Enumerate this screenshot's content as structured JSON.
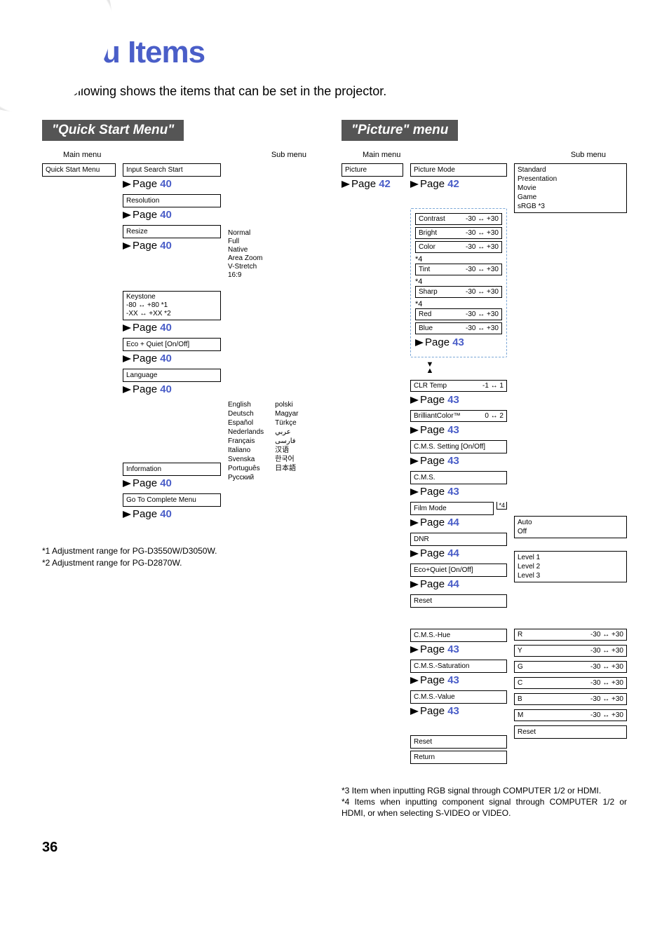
{
  "title": "Menu Items",
  "intro": "The following shows the items that can be set in the projector.",
  "main_menu_label": "Main menu",
  "sub_menu_label": "Sub menu",
  "page_word": "Page",
  "page_number": "36",
  "quick_start": {
    "header": "\"Quick Start Menu\"",
    "main_box": "Quick Start Menu",
    "items": {
      "input_search": {
        "label": "Input Search Start",
        "page": "40"
      },
      "resolution": {
        "label": "Resolution",
        "page": "40"
      },
      "resize": {
        "label": "Resize",
        "page": "40",
        "sub": [
          "Normal",
          "Full",
          "Native",
          "Area Zoom",
          "V-Stretch",
          "16:9"
        ]
      },
      "keystone": {
        "label": "Keystone",
        "l1": "-80 ↔ +80 *1",
        "l2": "-XX ↔ +XX *2",
        "page": "40"
      },
      "eco_quiet": {
        "label": "Eco + Quiet [On/Off]",
        "page": "40"
      },
      "language": {
        "label": "Language",
        "page": "40",
        "left": [
          "English",
          "Deutsch",
          "Español",
          "Nederlands",
          "Français",
          "Italiano",
          "Svenska",
          "Português",
          "Русский"
        ],
        "right": [
          "polski",
          "Magyar",
          "Türkçe",
          "عربي",
          "فارسی",
          "汉语",
          "한국어",
          "日本語"
        ]
      },
      "information": {
        "label": "Information",
        "page": "40"
      },
      "goto_complete": {
        "label": "Go To Complete Menu",
        "page": "40"
      }
    },
    "footnotes": {
      "f1": "*1 Adjustment range for PG-D3550W/D3050W.",
      "f2": "*2 Adjustment range for PG-D2870W."
    }
  },
  "picture": {
    "header": "\"Picture\" menu",
    "main_box": "Picture",
    "main_page": "42",
    "picture_mode": {
      "label": "Picture Mode",
      "page": "42",
      "sub": [
        "Standard",
        "Presentation",
        "Movie",
        "Game",
        "sRGB *3"
      ]
    },
    "adjust_group": [
      {
        "name": "Contrast",
        "range": "-30 ↔ +30",
        "ann": ""
      },
      {
        "name": "Bright",
        "range": "-30 ↔ +30",
        "ann": ""
      },
      {
        "name": "Color",
        "range": "-30 ↔ +30",
        "ann": "*4"
      },
      {
        "name": "Tint",
        "range": "-30 ↔ +30",
        "ann": "*4"
      },
      {
        "name": "Sharp",
        "range": "-30 ↔ +30",
        "ann": "*4"
      },
      {
        "name": "Red",
        "range": "-30 ↔ +30",
        "ann": ""
      },
      {
        "name": "Blue",
        "range": "-30 ↔ +30",
        "ann": ""
      }
    ],
    "adjust_page": "43",
    "clr_temp": {
      "name": "CLR Temp",
      "range": "-1 ↔ 1",
      "page": "43"
    },
    "brilliant": {
      "name": "BrilliantColor™",
      "range": "0 ↔ 2",
      "page": "43"
    },
    "cms_setting": {
      "name": "C.M.S. Setting [On/Off]",
      "page": "43"
    },
    "cms": {
      "name": "C.M.S.",
      "page": "43"
    },
    "film_mode": {
      "name": "Film Mode",
      "page": "44",
      "ann": "*4",
      "sub": [
        "Auto",
        "Off"
      ]
    },
    "dnr": {
      "name": "DNR",
      "page": "44",
      "sub": [
        "Level 1",
        "Level 2",
        "Level 3"
      ]
    },
    "eco_quiet2": {
      "name": "Eco+Quiet [On/Off]",
      "page": "44"
    },
    "reset": {
      "name": "Reset"
    },
    "cms_hue": {
      "name": "C.M.S.-Hue",
      "page": "43"
    },
    "cms_sat": {
      "name": "C.M.S.-Saturation",
      "page": "43"
    },
    "cms_val": {
      "name": "C.M.S.-Value",
      "page": "43"
    },
    "reset2": "Reset",
    "return": "Return",
    "cms_colors": [
      {
        "c": "R",
        "r": "-30 ↔ +30"
      },
      {
        "c": "Y",
        "r": "-30 ↔ +30"
      },
      {
        "c": "G",
        "r": "-30 ↔ +30"
      },
      {
        "c": "C",
        "r": "-30 ↔ +30"
      },
      {
        "c": "B",
        "r": "-30 ↔ +30"
      },
      {
        "c": "M",
        "r": "-30 ↔ +30"
      }
    ],
    "cms_reset": "Reset",
    "footnotes": {
      "f3": "*3 Item when inputting RGB signal through COMPUTER 1/2 or HDMI.",
      "f4": "*4 Items when inputting component signal through COMPUTER 1/2 or HDMI, or when selecting S-VIDEO or VIDEO."
    }
  }
}
